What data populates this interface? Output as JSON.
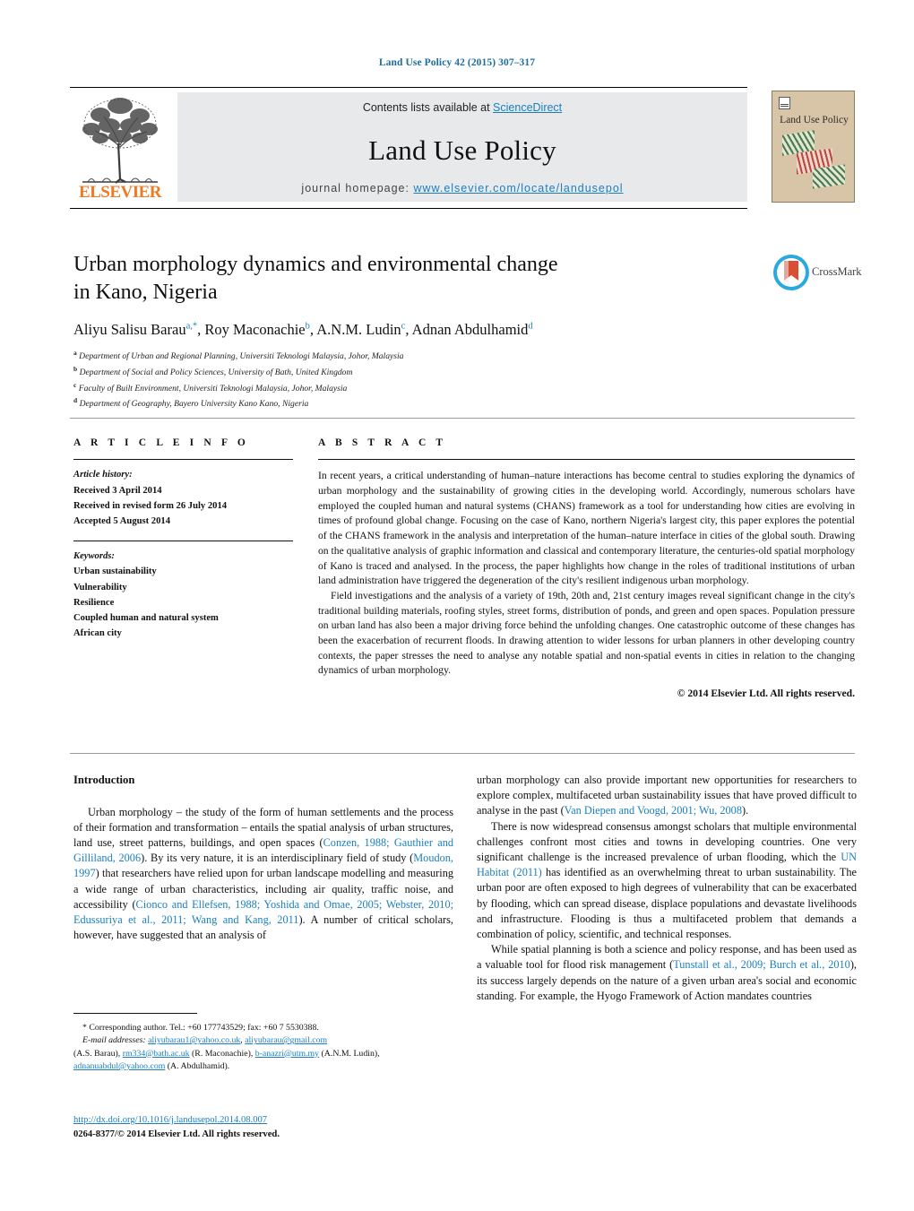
{
  "running_head": "Land Use Policy 42 (2015) 307–317",
  "header": {
    "contents_prefix": "Contents lists available at ",
    "sciencedirect": "ScienceDirect",
    "journal_name": "Land Use Policy",
    "homepage_prefix": "journal homepage: ",
    "homepage_url": "www.elsevier.com/locate/landusepol",
    "publisher_wordmark": "ELSEVIER",
    "cover_title": "Land Use Policy",
    "link_color": "#1a7fc1",
    "band_color": "#e8e9eb"
  },
  "title": {
    "line1": "Urban morphology dynamics and environmental change",
    "line2": "in Kano, Nigeria"
  },
  "crossmark": {
    "label": "CrossMark"
  },
  "authors": [
    {
      "name": "Aliyu Salisu Barau",
      "sup": "a,*"
    },
    {
      "name": "Roy Maconachie",
      "sup": "b"
    },
    {
      "name": "A.N.M. Ludin",
      "sup": "c"
    },
    {
      "name": "Adnan Abdulhamid",
      "sup": "d"
    }
  ],
  "affiliations": [
    {
      "mark": "a",
      "text": "Department of Urban and Regional Planning, Universiti Teknologi Malaysia, Johor, Malaysia"
    },
    {
      "mark": "b",
      "text": "Department of Social and Policy Sciences, University of Bath, United Kingdom"
    },
    {
      "mark": "c",
      "text": "Faculty of Built Environment, Universiti Teknologi Malaysia, Johor, Malaysia"
    },
    {
      "mark": "d",
      "text": "Department of Geography, Bayero University Kano Kano, Nigeria"
    }
  ],
  "article_info": {
    "heading": "A R T I C L E   I N F O",
    "history_label": "Article history:",
    "history": [
      "Received 3 April 2014",
      "Received in revised form 26 July 2014",
      "Accepted 5 August 2014"
    ],
    "keywords_label": "Keywords:",
    "keywords": [
      "Urban sustainability",
      "Vulnerability",
      "Resilience",
      "Coupled human and natural system",
      "African city"
    ]
  },
  "abstract": {
    "heading": "A B S T R A C T",
    "paragraphs": [
      "In recent years, a critical understanding of human–nature interactions has become central to studies exploring the dynamics of urban morphology and the sustainability of growing cities in the developing world. Accordingly, numerous scholars have employed the coupled human and natural systems (CHANS) framework as a tool for understanding how cities are evolving in times of profound global change. Focusing on the case of Kano, northern Nigeria's largest city, this paper explores the potential of the CHANS framework in the analysis and interpretation of the human–nature interface in cities of the global south. Drawing on the qualitative analysis of graphic information and classical and contemporary literature, the centuries-old spatial morphology of Kano is traced and analysed. In the process, the paper highlights how change in the roles of traditional institutions of urban land administration have triggered the degeneration of the city's resilient indigenous urban morphology.",
      "Field investigations and the analysis of a variety of 19th, 20th and, 21st century images reveal significant change in the city's traditional building materials, roofing styles, street forms, distribution of ponds, and green and open spaces. Population pressure on urban land has also been a major driving force behind the unfolding changes. One catastrophic outcome of these changes has been the exacerbation of recurrent floods. In drawing attention to wider lessons for urban planners in other developing country contexts, the paper stresses the need to analyse any notable spatial and non-spatial events in cities in relation to the changing dynamics of urban morphology."
    ],
    "copyright": "© 2014 Elsevier Ltd. All rights reserved."
  },
  "body": {
    "section_heading": "Introduction",
    "left_paragraphs": [
      [
        {
          "t": "Urban morphology – the study of the form of human settlements and the process of their formation and transformation – entails the spatial analysis of urban structures, land use, street patterns, buildings, and open spaces ("
        },
        {
          "t": "Conzen, 1988; Gauthier and Gilliland, 2006",
          "ref": true
        },
        {
          "t": "). By its very nature, it is an interdisciplinary field of study ("
        },
        {
          "t": "Moudon, 1997",
          "ref": true
        },
        {
          "t": ") that researchers have relied upon for urban landscape modelling and measuring a wide range of urban characteristics, including air quality, traffic noise, and accessibility ("
        },
        {
          "t": "Cionco and Ellefsen, 1988; Yoshida and Omae, 2005; Webster, 2010; Edussuriya et al., 2011; Wang and Kang, 2011",
          "ref": true
        },
        {
          "t": "). A number of critical scholars, however, have suggested that an analysis of"
        }
      ]
    ],
    "right_paragraphs": [
      [
        {
          "t": "urban morphology can also provide important new opportunities for researchers to explore complex, multifaceted urban sustainability issues that have proved difficult to analyse in the past ("
        },
        {
          "t": "Van Diepen and Voogd, 2001; Wu, 2008",
          "ref": true
        },
        {
          "t": ")."
        }
      ],
      [
        {
          "t": "There is now widespread consensus amongst scholars that multiple environmental challenges confront most cities and towns in developing countries. One very significant challenge is the increased prevalence of urban flooding, which the "
        },
        {
          "t": "UN Habitat (2011)",
          "ref": true
        },
        {
          "t": " has identified as an overwhelming threat to urban sustainability. The urban poor are often exposed to high degrees of vulnerability that can be exacerbated by flooding, which can spread disease, displace populations and devastate livelihoods and infrastructure. Flooding is thus a multifaceted problem that demands a combination of policy, scientific, and technical responses."
        }
      ],
      [
        {
          "t": "While spatial planning is both a science and policy response, and has been used as a valuable tool for flood risk management ("
        },
        {
          "t": "Tunstall et al., 2009; Burch et al., 2010",
          "ref": true
        },
        {
          "t": "), its success largely depends on the nature of a given urban area's social and economic standing. For example, the Hyogo Framework of Action mandates countries"
        }
      ]
    ]
  },
  "footnote": {
    "corresponding": "* Corresponding author. Tel.: +60 177743529; fax: +60 7 5530388.",
    "email_label": "E-mail addresses:",
    "emails": [
      {
        "addr": "aliyubarau1@yahoo.co.uk",
        "sep": ", "
      },
      {
        "addr": "aliyubarau@gmail.com",
        "sep": ""
      }
    ],
    "email_owner_1": "(A.S. Barau),",
    "email_2": "rm334@bath.ac.uk",
    "email_owner_2": "(R. Maconachie),",
    "email_3": "b-anazri@utm.my",
    "email_owner_3": "(A.N.M. Ludin),",
    "email_4": "adnanuabdul@yahoo.com",
    "email_owner_4": "(A. Abdulhamid)."
  },
  "footer": {
    "doi": "http://dx.doi.org/10.1016/j.landusepol.2014.08.007",
    "issn": "0264-8377/© 2014 Elsevier Ltd. All rights reserved."
  }
}
